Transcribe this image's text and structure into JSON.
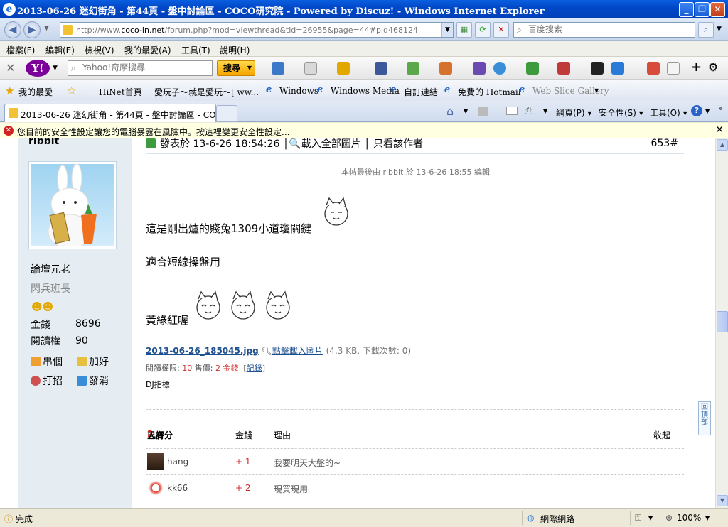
{
  "window": {
    "title": "2013-06-26 迷幻街角 - 第44頁 - 盤中討論區 - COCO研究院 - Powered by Discuz! - Windows Internet Explorer"
  },
  "address": {
    "url_prefix": "http://www.",
    "url_domain": "coco-in.net",
    "url_path": "/forum.php?mod=viewthread&tid=26955&page=44#pid468124",
    "search_placeholder": "百度搜索"
  },
  "menu": [
    "檔案(F)",
    "編輯(E)",
    "檢視(V)",
    "我的最愛(A)",
    "工具(T)",
    "說明(H)"
  ],
  "yahoo": {
    "logo": "Y!",
    "search_placeholder": "Yahoo!奇摩搜尋",
    "search_button": "搜尋"
  },
  "favorites": {
    "label": "我的最愛",
    "items": [
      "HiNet首頁",
      "愛玩子～就是愛玩～[ ww...",
      "Windows",
      "Windows Media",
      "自訂連結",
      "免費的 Hotmail",
      "Web Slice Gallery"
    ]
  },
  "tab": {
    "title": "2013-06-26 迷幻街角 - 第44頁 - 盤中討論區 - COC..."
  },
  "commands": [
    "網頁(P)",
    "安全性(S)",
    "工具(O)"
  ],
  "infobar": {
    "message": "您目前的安全性設定讓您的電腦暴露在風險中。按這裡變更安全性設定..."
  },
  "user": {
    "name": "ribbit",
    "title": "論壇元老",
    "rank": "閃兵班長",
    "stats": [
      {
        "label": "金錢",
        "value": "8696"
      },
      {
        "label": "閱讀權",
        "value": "90"
      }
    ],
    "actions": [
      "串個",
      "加好",
      "打招",
      "發消"
    ]
  },
  "post": {
    "meta": "發表於 13-6-26 18:54:26 │🔍載入全部圖片 │ 只看該作者",
    "floor": "653#",
    "edited": "本帖最後由 ribbit 於 13-6-26 18:55 編輯",
    "line1": "這是剛出爐的賤兔1309小道瓊關鍵",
    "line2": "適合短線操盤用",
    "line3": "黃綠紅喔",
    "attachment": {
      "filename": "2013-06-26_185045.jpg",
      "download": "點擊載入圖片",
      "info": "(4.3 KB, 下載次數: 0)"
    },
    "permission": {
      "read_label": "閱讀權限:",
      "read_value": "10",
      "price_label": "售價:",
      "price_value": "2 金錢",
      "record": "記錄"
    },
    "signature": "DJ指標"
  },
  "ratings": {
    "header_prefix": "已有",
    "count": "2",
    "header_suffix": "人評分",
    "col_money": "金錢",
    "col_reason": "理由",
    "collapse": "收起",
    "rows": [
      {
        "user": "hang",
        "amount": "+ 1",
        "reason": "我要明天大盤的~"
      },
      {
        "user": "kk66",
        "amount": "+ 2",
        "reason": "現買現用"
      }
    ]
  },
  "back_to_top": "回頂部",
  "status": {
    "text": "完成",
    "zone": "網際網路",
    "zoom": "100%"
  },
  "colors": {
    "accent_red": "#d0312d",
    "link_blue": "#1c4f8f",
    "sidebar_bg": "#e5edf2"
  }
}
